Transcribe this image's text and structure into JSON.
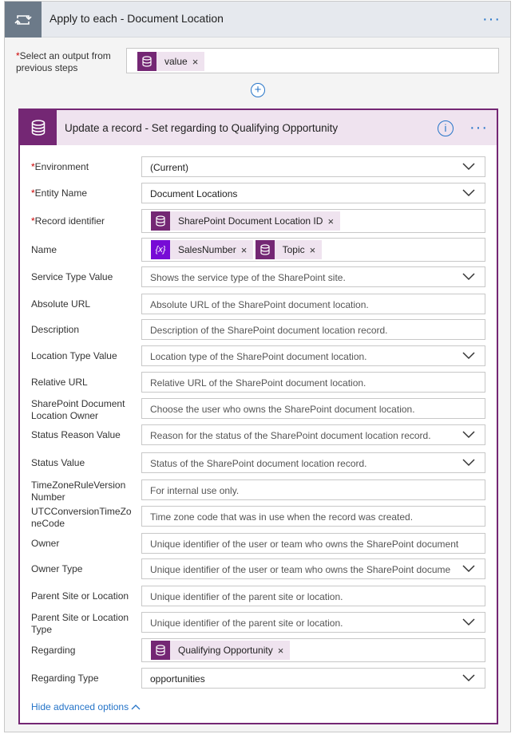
{
  "loop": {
    "title": "Apply to each - Document Location",
    "select_label_req": "*",
    "select_label": "Select an output from previous steps",
    "select_token": "value"
  },
  "action": {
    "title": "Update a record - Set regarding to Qualifying Opportunity",
    "hide_link": "Hide advanced options"
  },
  "fields": [
    {
      "label": "Environment",
      "required": true,
      "value": "(Current)",
      "dropdown": true
    },
    {
      "label": "Entity Name",
      "required": true,
      "value": "Document Locations",
      "dropdown": true
    },
    {
      "label": "Record identifier",
      "required": true,
      "tokens": [
        "SharePoint Document Location ID"
      ]
    },
    {
      "label": "Name",
      "required": false,
      "tokens": [
        "SalesNumber",
        "Topic"
      ]
    },
    {
      "label": "Service Type Value",
      "placeholder": "Shows the service type of the SharePoint site.",
      "dropdown": true
    },
    {
      "label": "Absolute URL",
      "placeholder": "Absolute URL of the SharePoint document location."
    },
    {
      "label": "Description",
      "placeholder": "Description of the SharePoint document location record."
    },
    {
      "label": "Location Type Value",
      "placeholder": "Location type of the SharePoint document location.",
      "dropdown": true
    },
    {
      "label": "Relative URL",
      "placeholder": "Relative URL of the SharePoint document location."
    },
    {
      "label": "SharePoint Document Location Owner",
      "placeholder": "Choose the user who owns the SharePoint document location."
    },
    {
      "label": "Status Reason Value",
      "placeholder": "Reason for the status of the SharePoint document location record.",
      "dropdown": true
    },
    {
      "label": "Status Value",
      "placeholder": "Status of the SharePoint document location record.",
      "dropdown": true
    },
    {
      "label": "TimeZoneRuleVersion Number",
      "placeholder": "For internal use only."
    },
    {
      "label": "UTCConversionTimeZo neCode",
      "placeholder": "Time zone code that was in use when the record was created."
    },
    {
      "label": "Owner",
      "placeholder": "Unique identifier of the user or team who owns the SharePoint document"
    },
    {
      "label": "Owner Type",
      "placeholder": "Unique identifier of the user or team who owns the SharePoint docume",
      "dropdown": true
    },
    {
      "label": "Parent Site or Location",
      "placeholder": "Unique identifier of the parent site or location."
    },
    {
      "label": "Parent Site or Location Type",
      "placeholder": "Unique identifier of the parent site or location.",
      "dropdown": true
    },
    {
      "label": "Regarding",
      "tokens": [
        "Qualifying Opportunity"
      ]
    },
    {
      "label": "Regarding Type",
      "value": "opportunities",
      "dropdown": true
    }
  ],
  "colors": {
    "accent": "#742774",
    "link": "#2574c8",
    "token_bg": "#efe3ef"
  }
}
